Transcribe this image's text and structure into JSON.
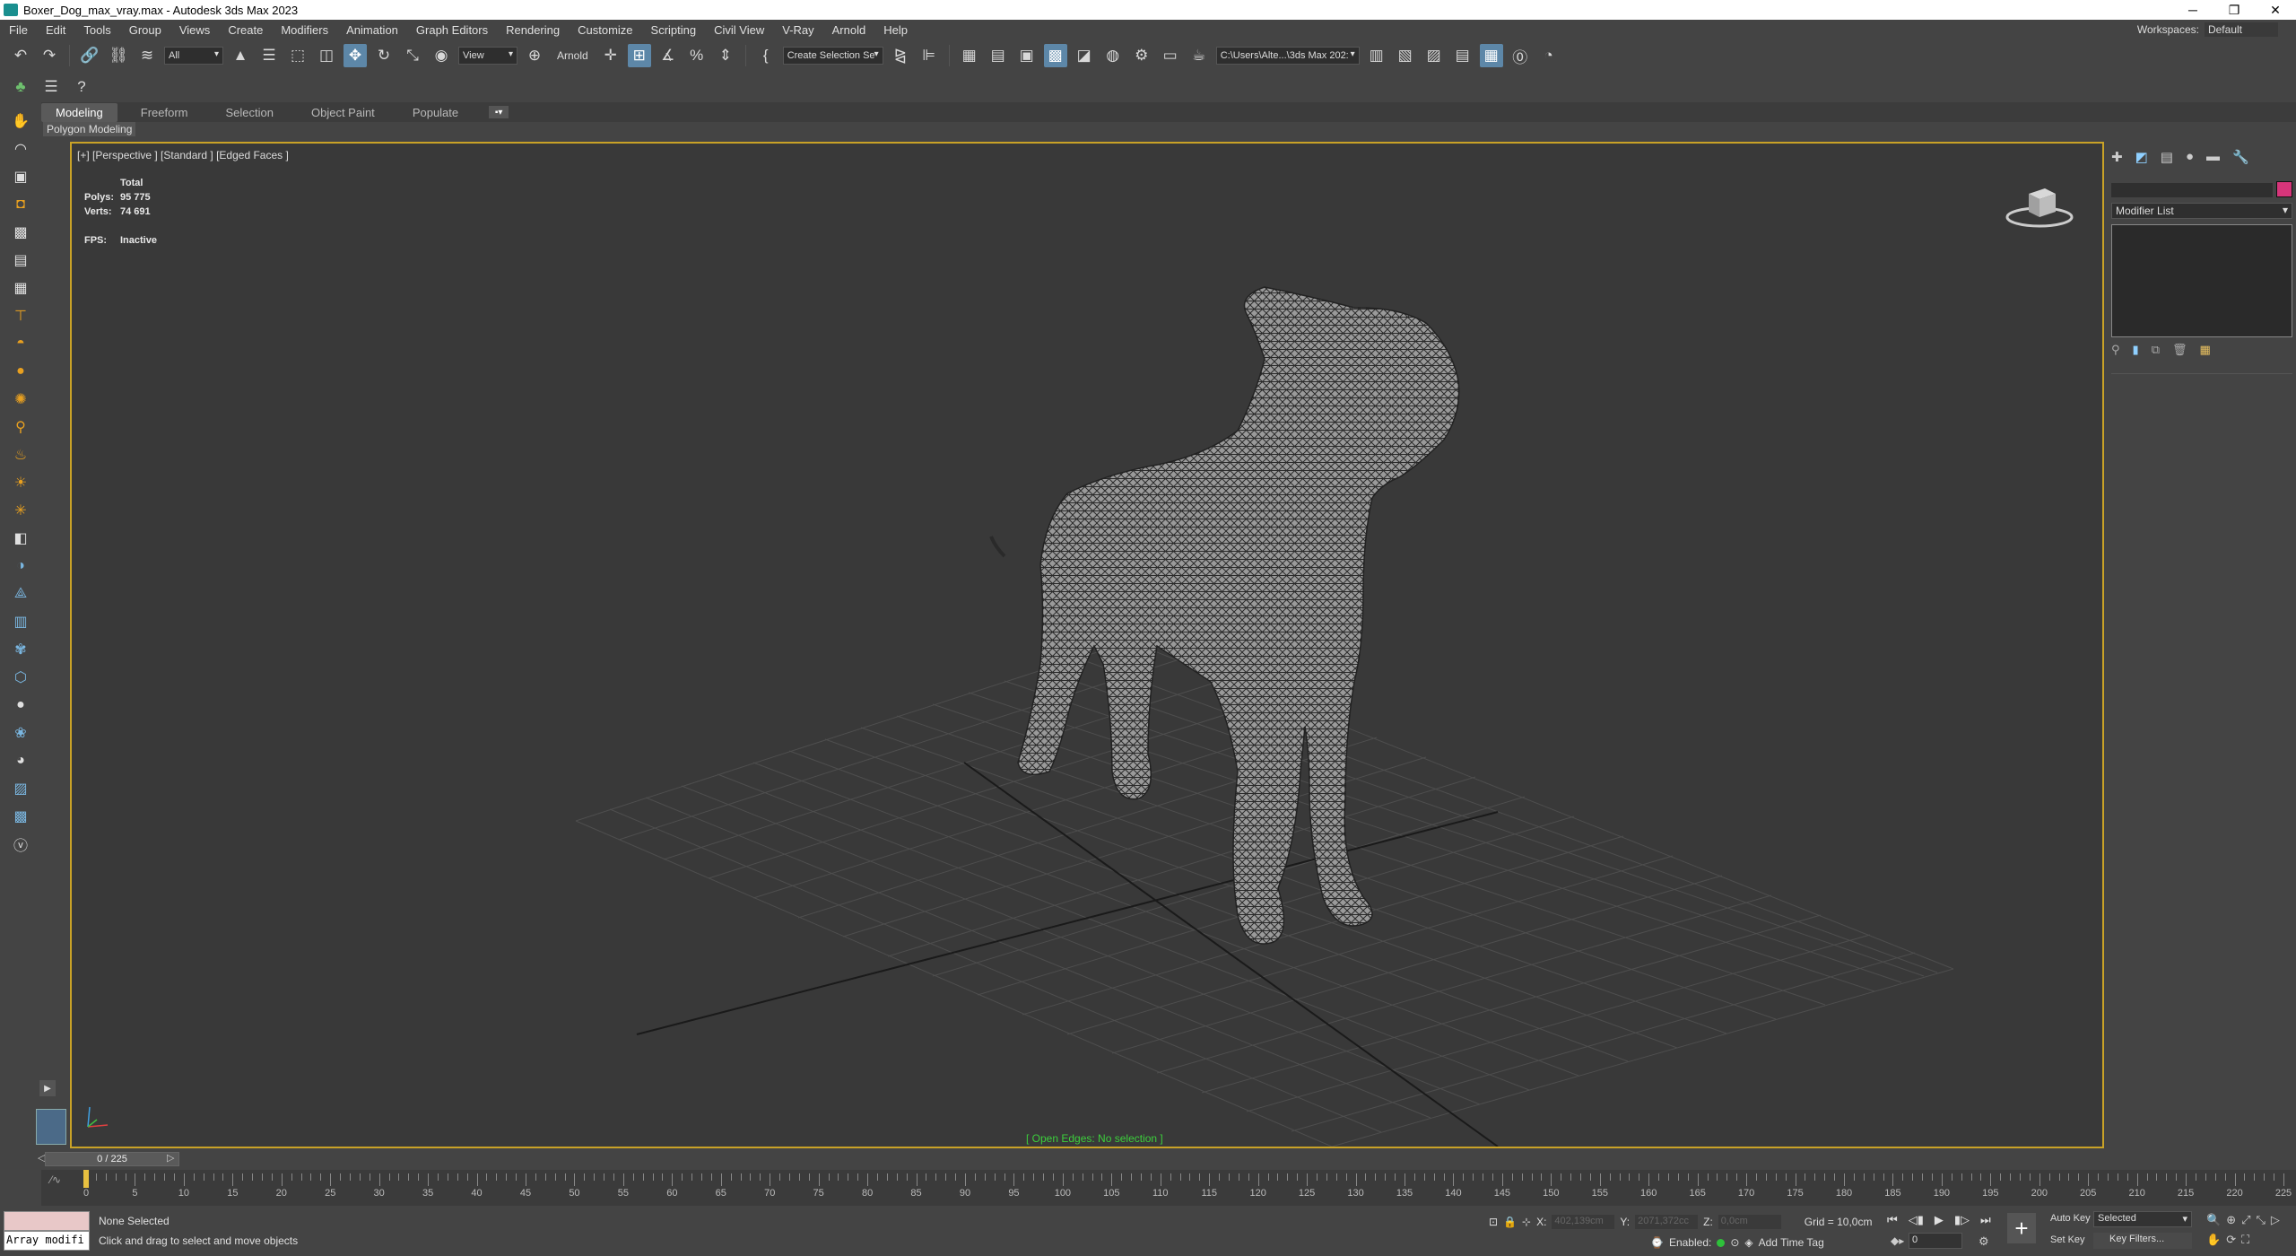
{
  "window": {
    "title": "Boxer_Dog_max_vray.max - Autodesk 3ds Max 2023",
    "minimize": "─",
    "restore": "❐",
    "close": "✕"
  },
  "menu": {
    "items": [
      "File",
      "Edit",
      "Tools",
      "Group",
      "Views",
      "Create",
      "Modifiers",
      "Animation",
      "Graph Editors",
      "Rendering",
      "Customize",
      "Scripting",
      "Civil View",
      "V-Ray",
      "Arnold",
      "Help"
    ],
    "workspaces_label": "Workspaces:",
    "workspaces_value": "Default"
  },
  "toolbar": {
    "selection_filter": "All",
    "ref_coord": "View",
    "arnold_label": "Arnold",
    "named_selection": "Create Selection Se",
    "project_path": "C:\\Users\\Alte...\\3ds Max 202:"
  },
  "ribbon": {
    "tabs": [
      "Modeling",
      "Freeform",
      "Selection",
      "Object Paint",
      "Populate"
    ],
    "active_tab": "Modeling",
    "sub_label": "Polygon Modeling"
  },
  "viewport": {
    "label": "[+] [Perspective ] [Standard ] [Edged Faces ]",
    "stats_header": "Total",
    "polys_label": "Polys:",
    "polys_value": "95 775",
    "verts_label": "Verts:",
    "verts_value": "74 691",
    "fps_label": "FPS:",
    "fps_value": "Inactive",
    "status": "[ Open Edges: No selection ]"
  },
  "command_panel": {
    "modifier_list": "Modifier List",
    "object_color": "#d6357a"
  },
  "timeline": {
    "frame_display": "0 / 225",
    "ticks": [
      0,
      5,
      10,
      15,
      20,
      25,
      30,
      35,
      40,
      45,
      50,
      55,
      60,
      65,
      70,
      75,
      80,
      85,
      90,
      95,
      100,
      105,
      110,
      115,
      120,
      125,
      130,
      135,
      140,
      145,
      150,
      155,
      160,
      165,
      170,
      175,
      180,
      185,
      190,
      195,
      200,
      205,
      210,
      215,
      220,
      225
    ]
  },
  "status": {
    "maxscript_text": "Array modifi",
    "selection": "None Selected",
    "hint": "Click and drag to select and move objects",
    "x_label": "X:",
    "x_value": "402,139cm",
    "y_label": "Y:",
    "y_value": "2071,372cc",
    "z_label": "Z:",
    "z_value": "0,0cm",
    "grid": "Grid = 10,0cm",
    "enabled_label": "Enabled:",
    "add_time_tag": "Add Time Tag",
    "frame_value": "0",
    "auto_key": "Auto Key",
    "set_key": "Set Key",
    "key_mode": "Selected",
    "key_filters": "Key Filters..."
  }
}
